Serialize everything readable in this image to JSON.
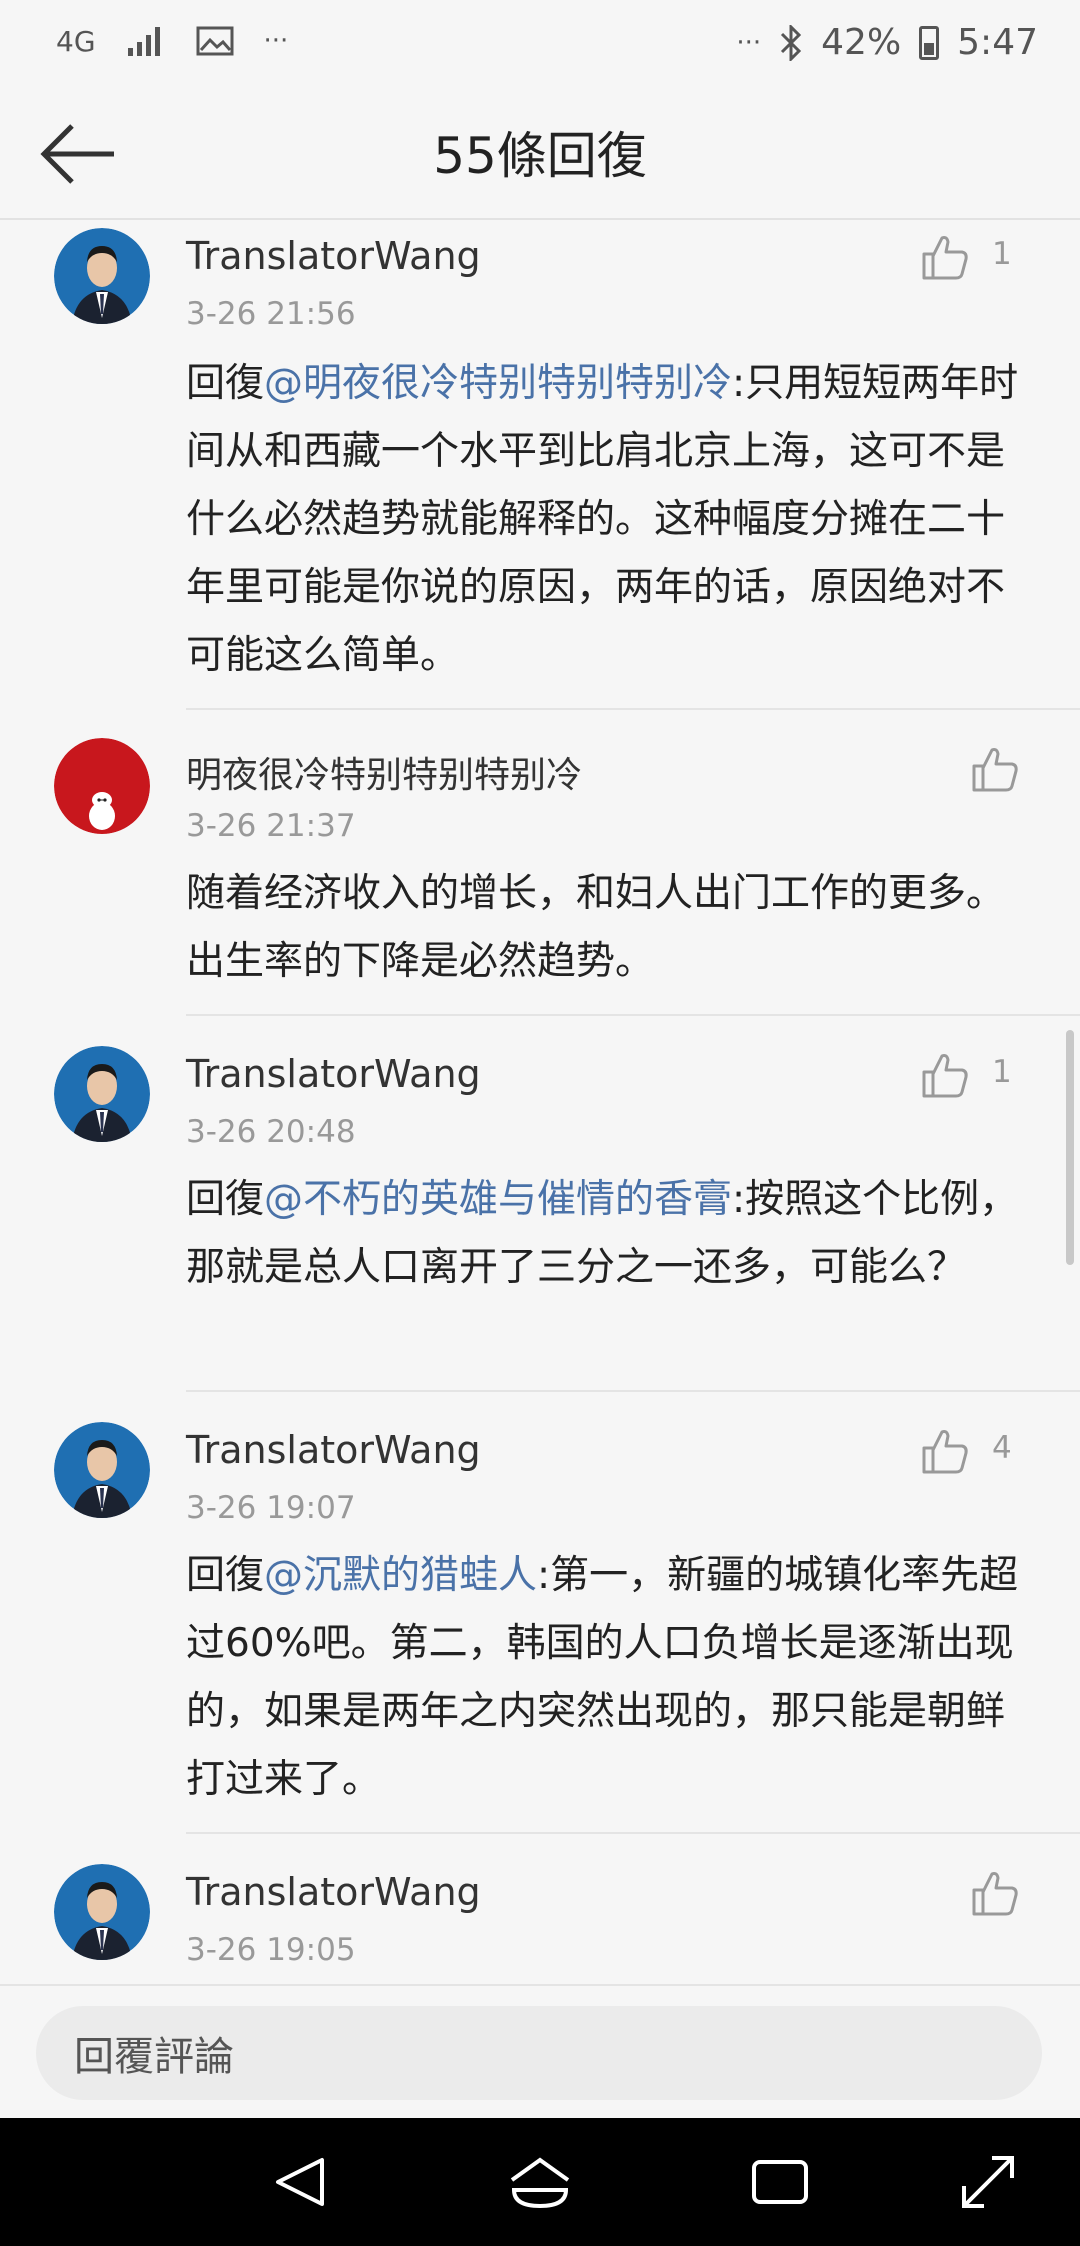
{
  "status_bar": {
    "network": "4G",
    "battery_percent": "42%",
    "time": "5:47",
    "more_left": "···",
    "more_right": "···"
  },
  "header": {
    "title": "55條回復"
  },
  "comments": [
    {
      "username": "TranslatorWang",
      "time": "3-26 21:56",
      "likes": "1",
      "prefix": "回復",
      "mention": "@明夜很冷特别特别特别冷",
      "text": ":只用短短两年时间从和西藏一个水平到比肩北京上海，这可不是什么必然趋势就能解释的。这种幅度分摊在二十年里可能是你说的原因，两年的话，原因绝对不可能这么简单。"
    },
    {
      "username": "明夜很冷特别特别特别冷",
      "time": "3-26 21:37",
      "likes": "",
      "prefix": "",
      "mention": "",
      "text": "随着经济收入的增长，和妇人出门工作的更多。出生率的下降是必然趋势。"
    },
    {
      "username": "TranslatorWang",
      "time": "3-26 20:48",
      "likes": "1",
      "prefix": "回復",
      "mention": "@不朽的英雄与催情的香膏",
      "text": ":按照这个比例，那就是总人口离开了三分之一还多，可能么？"
    },
    {
      "username": "TranslatorWang",
      "time": "3-26 19:07",
      "likes": "4",
      "prefix": "回復",
      "mention": "@沉默的猎蛙人",
      "text": ":第一，新疆的城镇化率先超过60%吧。第二，韩国的人口负增长是逐渐出现的，如果是两年之内突然出现的，那只能是朝鲜打过来了。"
    },
    {
      "username": "TranslatorWang",
      "time": "3-26 19:05",
      "likes": "",
      "prefix": "",
      "mention": "",
      "text": ""
    }
  ],
  "reply_bar": {
    "placeholder": "回覆評論"
  },
  "colors": {
    "mention": "#4a72a8",
    "avatar_red": "#c8171d",
    "avatar_blue": "#1f6fb2"
  }
}
